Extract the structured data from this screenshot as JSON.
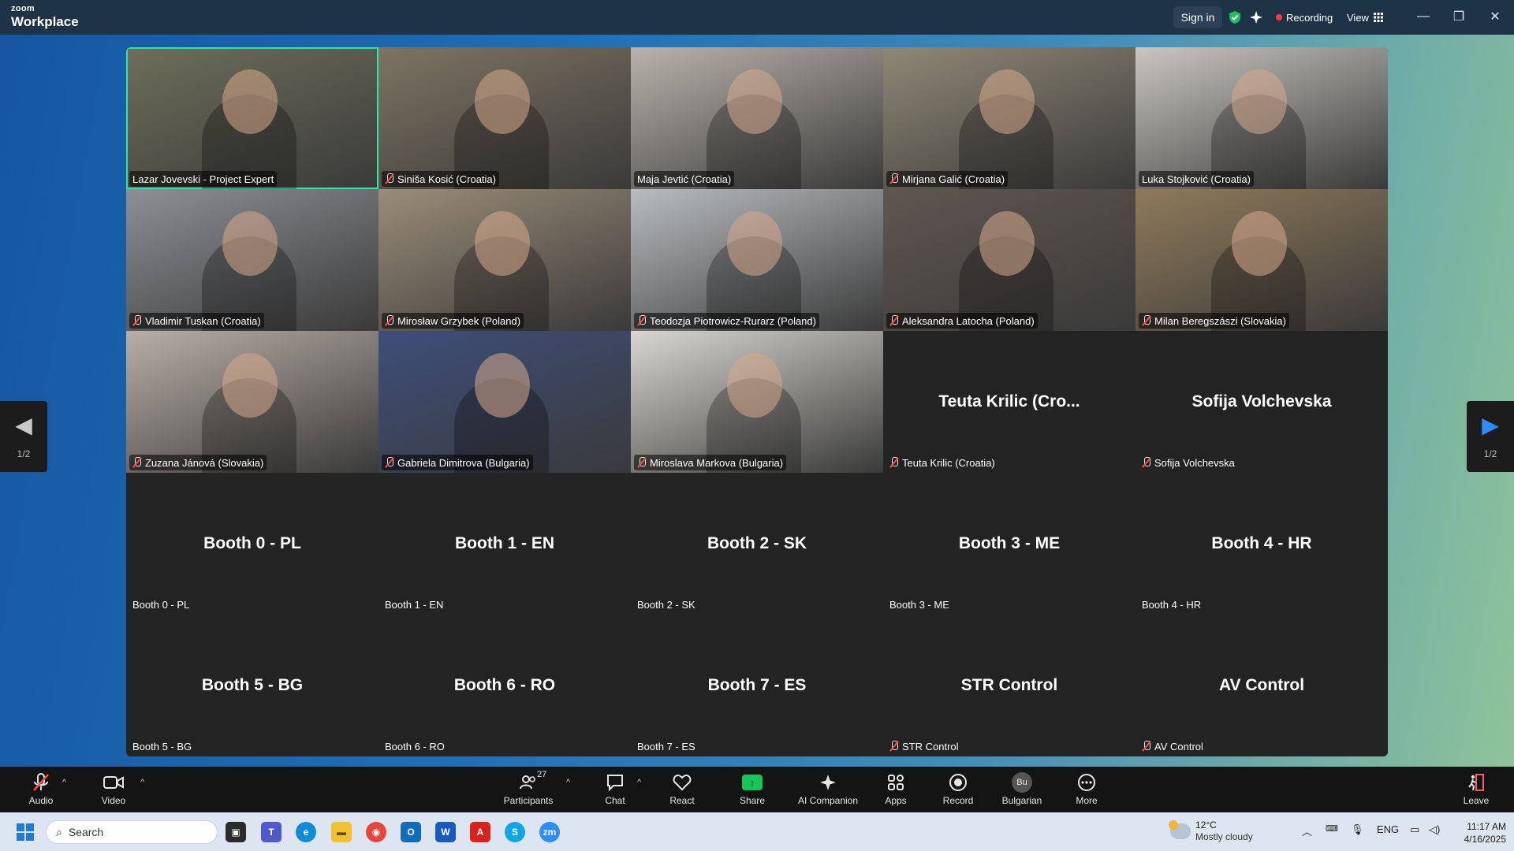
{
  "titlebar": {
    "brand_small": "zoom",
    "brand_large": "Workplace",
    "sign_in": "Sign in",
    "recording": "Recording",
    "view": "View",
    "icons": [
      "shield-check-icon",
      "sparkle-icon",
      "grid-icon"
    ],
    "colors": {
      "shield": "#1fbf5a",
      "recording_dot": "#ff3b3b"
    }
  },
  "grid": {
    "active_speaker_color": "#2ee6a6",
    "tiles": [
      {
        "name": "Lazar Jovevski - Project Expert",
        "muted": false,
        "video": true,
        "bg": "#6e6e5a",
        "active": true
      },
      {
        "name": "Siniša Kosić (Croatia)",
        "muted": true,
        "video": true,
        "bg": "#7d7462"
      },
      {
        "name": "Maja Jevtić (Croatia)",
        "muted": false,
        "video": true,
        "bg": "#b8b3ab"
      },
      {
        "name": "Mirjana Galić (Croatia)",
        "muted": true,
        "video": true,
        "bg": "#8f8876"
      },
      {
        "name": "Luka Stojković (Croatia)",
        "muted": false,
        "video": true,
        "bg": "#c9c6c1"
      },
      {
        "name": "Vladimir Tuskan (Croatia)",
        "muted": true,
        "video": true,
        "bg": "#8d8f93"
      },
      {
        "name": "Mirosław Grzybek (Poland)",
        "muted": true,
        "video": true,
        "bg": "#9a8c78"
      },
      {
        "name": "Teodozja Piotrowicz-Rurarz (Poland)",
        "muted": true,
        "video": true,
        "bg": "#b9bcbf"
      },
      {
        "name": "Aleksandra Latocha (Poland)",
        "muted": true,
        "video": true,
        "bg": "#5f5650"
      },
      {
        "name": "Milan Beregszászi (Slovakia)",
        "muted": true,
        "video": true,
        "bg": "#8f7a5a"
      },
      {
        "name": "Zuzana Jánová (Slovakia)",
        "muted": true,
        "video": true,
        "bg": "#b8afa6"
      },
      {
        "name": "Gabriela Dimitrova (Bulgaria)",
        "muted": true,
        "video": true,
        "bg": "#3e4e7a"
      },
      {
        "name": "Miroslava Markova (Bulgaria)",
        "muted": true,
        "video": true,
        "bg": "#d8d6cf"
      },
      {
        "name": "Teuta Krilic (Croatia)",
        "muted": true,
        "video": false,
        "big": "Teuta Krilic (Cro..."
      },
      {
        "name": "Sofija Volchevska",
        "muted": true,
        "video": false,
        "big": "Sofija Volchevska"
      },
      {
        "name": "Booth 0 - PL",
        "muted": false,
        "video": false,
        "big": "Booth 0 - PL"
      },
      {
        "name": "Booth 1 - EN",
        "muted": false,
        "video": false,
        "big": "Booth 1 - EN"
      },
      {
        "name": "Booth 2 - SK",
        "muted": false,
        "video": false,
        "big": "Booth 2 - SK"
      },
      {
        "name": "Booth 3 - ME",
        "muted": false,
        "video": false,
        "big": "Booth 3 - ME"
      },
      {
        "name": "Booth 4 - HR",
        "muted": false,
        "video": false,
        "big": "Booth 4 - HR"
      },
      {
        "name": "Booth 5 - BG",
        "muted": false,
        "video": false,
        "big": "Booth 5 - BG"
      },
      {
        "name": "Booth 6 - RO",
        "muted": false,
        "video": false,
        "big": "Booth 6 - RO"
      },
      {
        "name": "Booth 7 - ES",
        "muted": false,
        "video": false,
        "big": "Booth 7 - ES"
      },
      {
        "name": "STR Control",
        "muted": true,
        "video": false,
        "big": "STR Control"
      },
      {
        "name": "AV Control",
        "muted": true,
        "video": false,
        "big": "AV Control"
      }
    ]
  },
  "pager": {
    "left_page": "1/2",
    "right_page": "1/2"
  },
  "toolbar": {
    "audio": "Audio",
    "video": "Video",
    "participants": "Participants",
    "participants_count": "27",
    "chat": "Chat",
    "react": "React",
    "share": "Share",
    "ai_companion": "AI Companion",
    "apps": "Apps",
    "record": "Record",
    "language": "Bulgarian",
    "language_badge": "Bu",
    "more": "More",
    "leave": "Leave",
    "colors": {
      "share": "#17c65a",
      "leave": "#ff5c5c"
    }
  },
  "taskbar": {
    "search_placeholder": "Search",
    "apps": [
      "task-view",
      "teams",
      "edge",
      "file-explorer",
      "chrome",
      "outlook",
      "word",
      "acrobat",
      "skype",
      "zoom"
    ],
    "weather_temp": "12°C",
    "weather_text": "Mostly cloudy",
    "lang": "ENG",
    "time": "11:17 AM",
    "date": "4/16/2025"
  }
}
